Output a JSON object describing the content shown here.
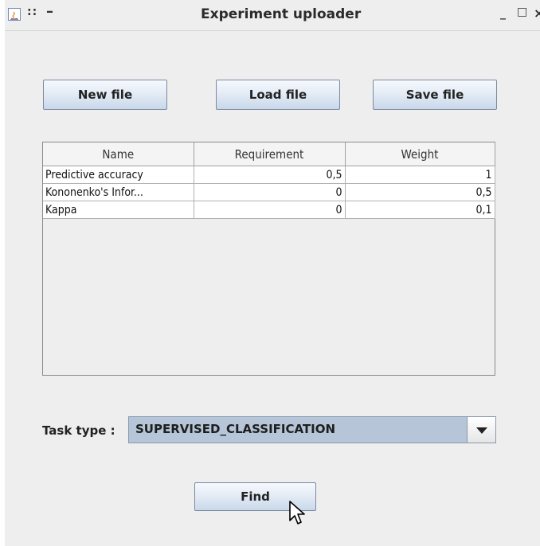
{
  "window": {
    "title": "Experiment uploader",
    "titlebar_left_glyphs": "::",
    "titlebar_dash": "–",
    "controls": {
      "minimize": "_",
      "maximize": "□",
      "close": "×"
    }
  },
  "toolbar": {
    "new_file": "New file",
    "load_file": "Load file",
    "save_file": "Save file"
  },
  "table": {
    "columns": [
      "Name",
      "Requirement",
      "Weight"
    ],
    "rows": [
      [
        "Predictive accuracy",
        "0,5",
        "1"
      ],
      [
        "Kononenko's Infor...",
        "0",
        "0,5"
      ],
      [
        "Kappa",
        "0",
        "0,1"
      ]
    ]
  },
  "task": {
    "label": "Task type :",
    "selected": "SUPERVISED_CLASSIFICATION"
  },
  "actions": {
    "find": "Find"
  },
  "colors": {
    "window_bg": "#eeeeee",
    "button_gradient_bottom": "#c9d8ea",
    "combo_bg": "#b6c6d8"
  }
}
